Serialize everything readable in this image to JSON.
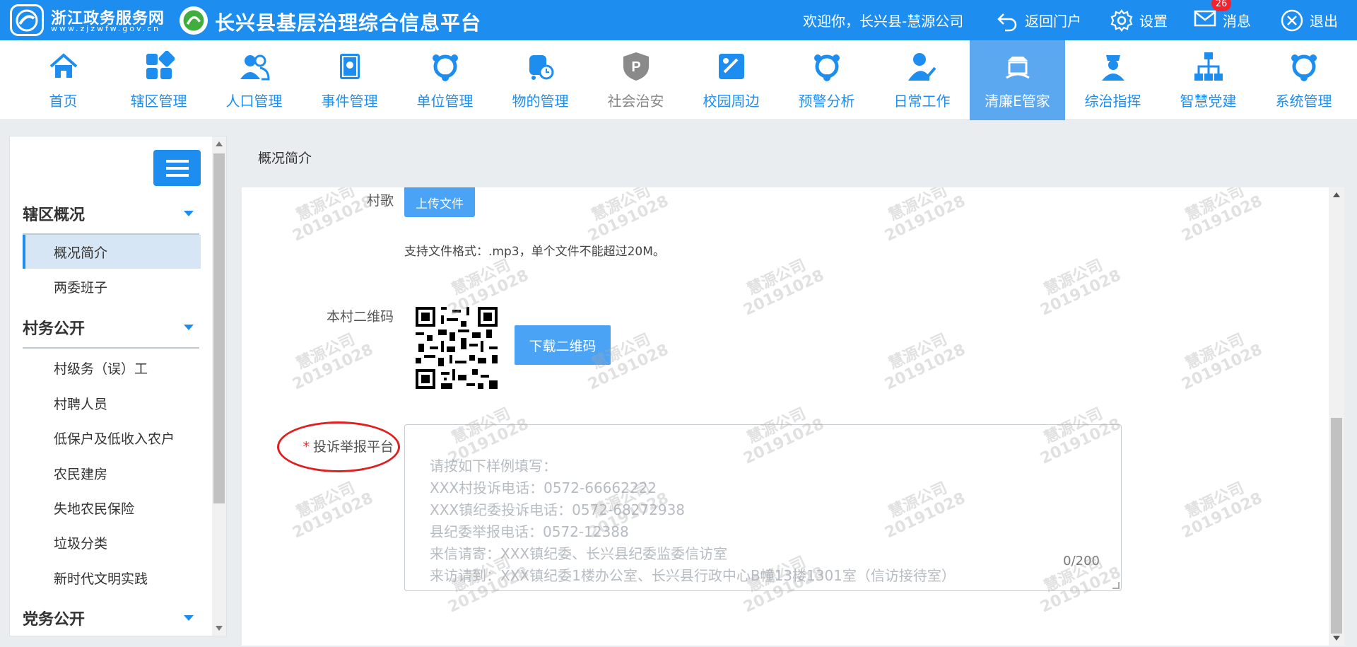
{
  "topbar": {
    "portal_name": "浙江政务服务网",
    "portal_url": "www.zjzwfw.gov.cn",
    "platform_title": "长兴县基层治理综合信息平台",
    "welcome": "欢迎你，长兴县-慧源公司",
    "return_label": "返回门户",
    "settings_label": "设置",
    "messages_label": "消息",
    "messages_badge": "26",
    "logout_label": "退出",
    "bar_color": "#1d8ef0"
  },
  "nav": {
    "items": [
      {
        "label": "首页",
        "icon": "home-icon"
      },
      {
        "label": "辖区管理",
        "icon": "grid-icon"
      },
      {
        "label": "人口管理",
        "icon": "people-icon"
      },
      {
        "label": "事件管理",
        "icon": "book-icon"
      },
      {
        "label": "单位管理",
        "icon": "network-icon"
      },
      {
        "label": "物的管理",
        "icon": "truck-icon"
      },
      {
        "label": "社会治安",
        "icon": "police-badge-icon"
      },
      {
        "label": "校园周边",
        "icon": "campus-icon"
      },
      {
        "label": "预警分析",
        "icon": "network-icon"
      },
      {
        "label": "日常工作",
        "icon": "user-edit-icon"
      },
      {
        "label": "清廉E管家",
        "icon": "building-icon"
      },
      {
        "label": "综治指挥",
        "icon": "officer-icon"
      },
      {
        "label": "智慧党建",
        "icon": "org-chart-icon"
      },
      {
        "label": "系统管理",
        "icon": "network-icon"
      }
    ],
    "active_index": 10
  },
  "sidebar": {
    "groups": [
      {
        "title": "辖区概况",
        "items": [
          "概况简介",
          "两委班子"
        ]
      },
      {
        "title": "村务公开",
        "items": [
          "村级务（误）工",
          "村聘人员",
          "低保户及低收入农户",
          "农民建房",
          "失地农民保险",
          "垃圾分类",
          "新时代文明实践"
        ]
      },
      {
        "title": "党务公开",
        "items": []
      }
    ],
    "active_item": "概况简介"
  },
  "main": {
    "breadcrumb": "概况简介",
    "song_label": "村歌",
    "upload_button": "上传文件",
    "upload_hint": "支持文件格式：.mp3，单个文件不能超过20M。",
    "qr_label": "本村二维码",
    "download_qr_button": "下载二维码",
    "complaint_label": "投诉举报平台",
    "complaint_placeholder": "请按如下样例填写：\nXXX村投诉电话：0572-66662222\nXXX镇纪委投诉电话：0572-68272938\n县纪委举报电话：0572-12388\n来信请寄：XXX镇纪委、长兴县纪委监委信访室\n来访请到：XXX镇纪委1楼办公室、长兴县行政中心B幢13楼1301室（信访接待室）",
    "complaint_counter": "0/200",
    "watermark_name": "慧源公司",
    "watermark_date": "20191028"
  }
}
